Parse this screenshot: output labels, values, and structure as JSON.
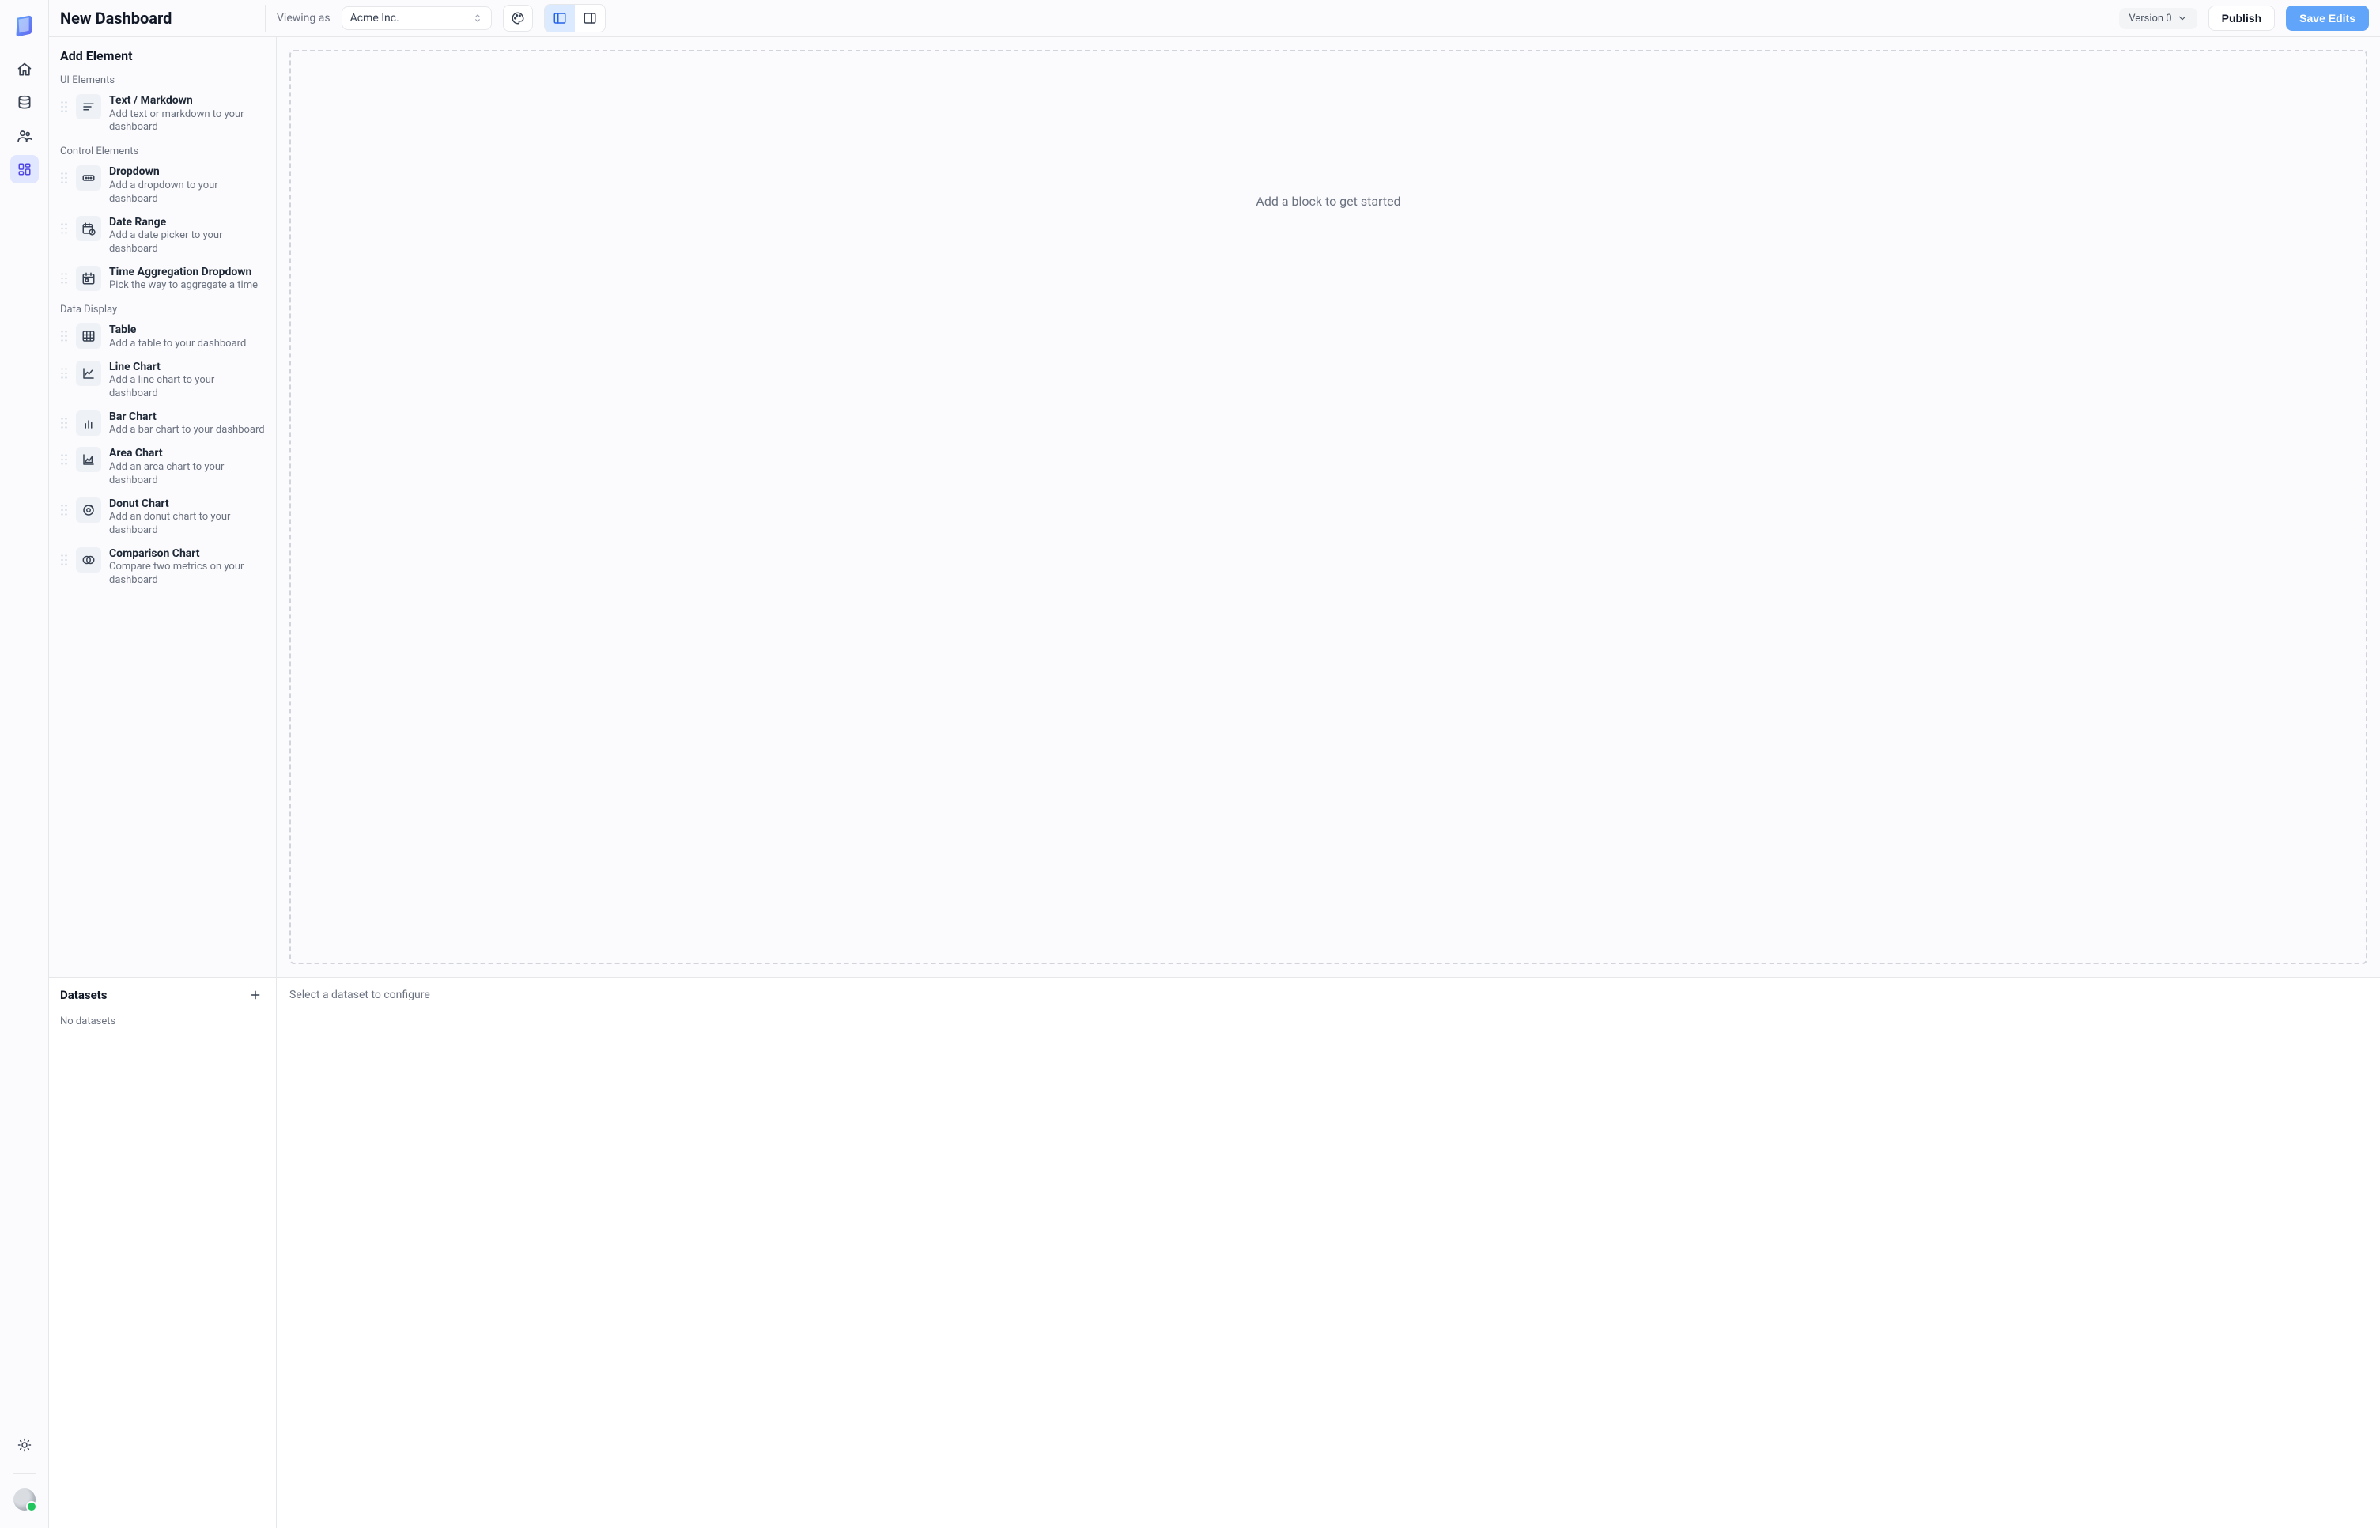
{
  "header": {
    "title": "New Dashboard",
    "viewing_as_label": "Viewing as",
    "org_selected": "Acme Inc.",
    "version_label": "Version 0",
    "publish_label": "Publish",
    "save_label": "Save Edits"
  },
  "rail": {
    "items": [
      {
        "name": "home",
        "active": false
      },
      {
        "name": "data",
        "active": false
      },
      {
        "name": "people",
        "active": false
      },
      {
        "name": "dashboards",
        "active": true
      }
    ]
  },
  "panel": {
    "title": "Add Element",
    "groups": [
      {
        "label": "UI Elements",
        "items": [
          {
            "id": "text",
            "icon": "text-icon",
            "title": "Text / Markdown",
            "desc": "Add text or markdown to your dashboard"
          }
        ]
      },
      {
        "label": "Control Elements",
        "items": [
          {
            "id": "dropdown",
            "icon": "dropdown-icon",
            "title": "Dropdown",
            "desc": "Add a dropdown to your dashboard"
          },
          {
            "id": "daterange",
            "icon": "calendar-clock-icon",
            "title": "Date Range",
            "desc": "Add a date picker to your dashboard"
          },
          {
            "id": "timeagg",
            "icon": "calendar-icon",
            "title": "Time Aggregation Dropdown",
            "desc": "Pick the way to aggregate a time"
          }
        ]
      },
      {
        "label": "Data Display",
        "items": [
          {
            "id": "table",
            "icon": "table-icon",
            "title": "Table",
            "desc": "Add a table to your dashboard"
          },
          {
            "id": "line",
            "icon": "line-chart-icon",
            "title": "Line Chart",
            "desc": "Add a line chart to your dashboard"
          },
          {
            "id": "bar",
            "icon": "bar-chart-icon",
            "title": "Bar Chart",
            "desc": "Add a bar chart to your dashboard"
          },
          {
            "id": "area",
            "icon": "area-chart-icon",
            "title": "Area Chart",
            "desc": "Add an area chart to your dashboard"
          },
          {
            "id": "donut",
            "icon": "donut-chart-icon",
            "title": "Donut Chart",
            "desc": "Add an donut chart to your dashboard"
          },
          {
            "id": "comparison",
            "icon": "comparison-chart-icon",
            "title": "Comparison Chart",
            "desc": "Compare two metrics on your dashboard"
          }
        ]
      }
    ]
  },
  "datasets": {
    "title": "Datasets",
    "empty_label": "No datasets",
    "config_placeholder": "Select a dataset to configure"
  },
  "canvas": {
    "empty_message": "Add a block to get started"
  }
}
